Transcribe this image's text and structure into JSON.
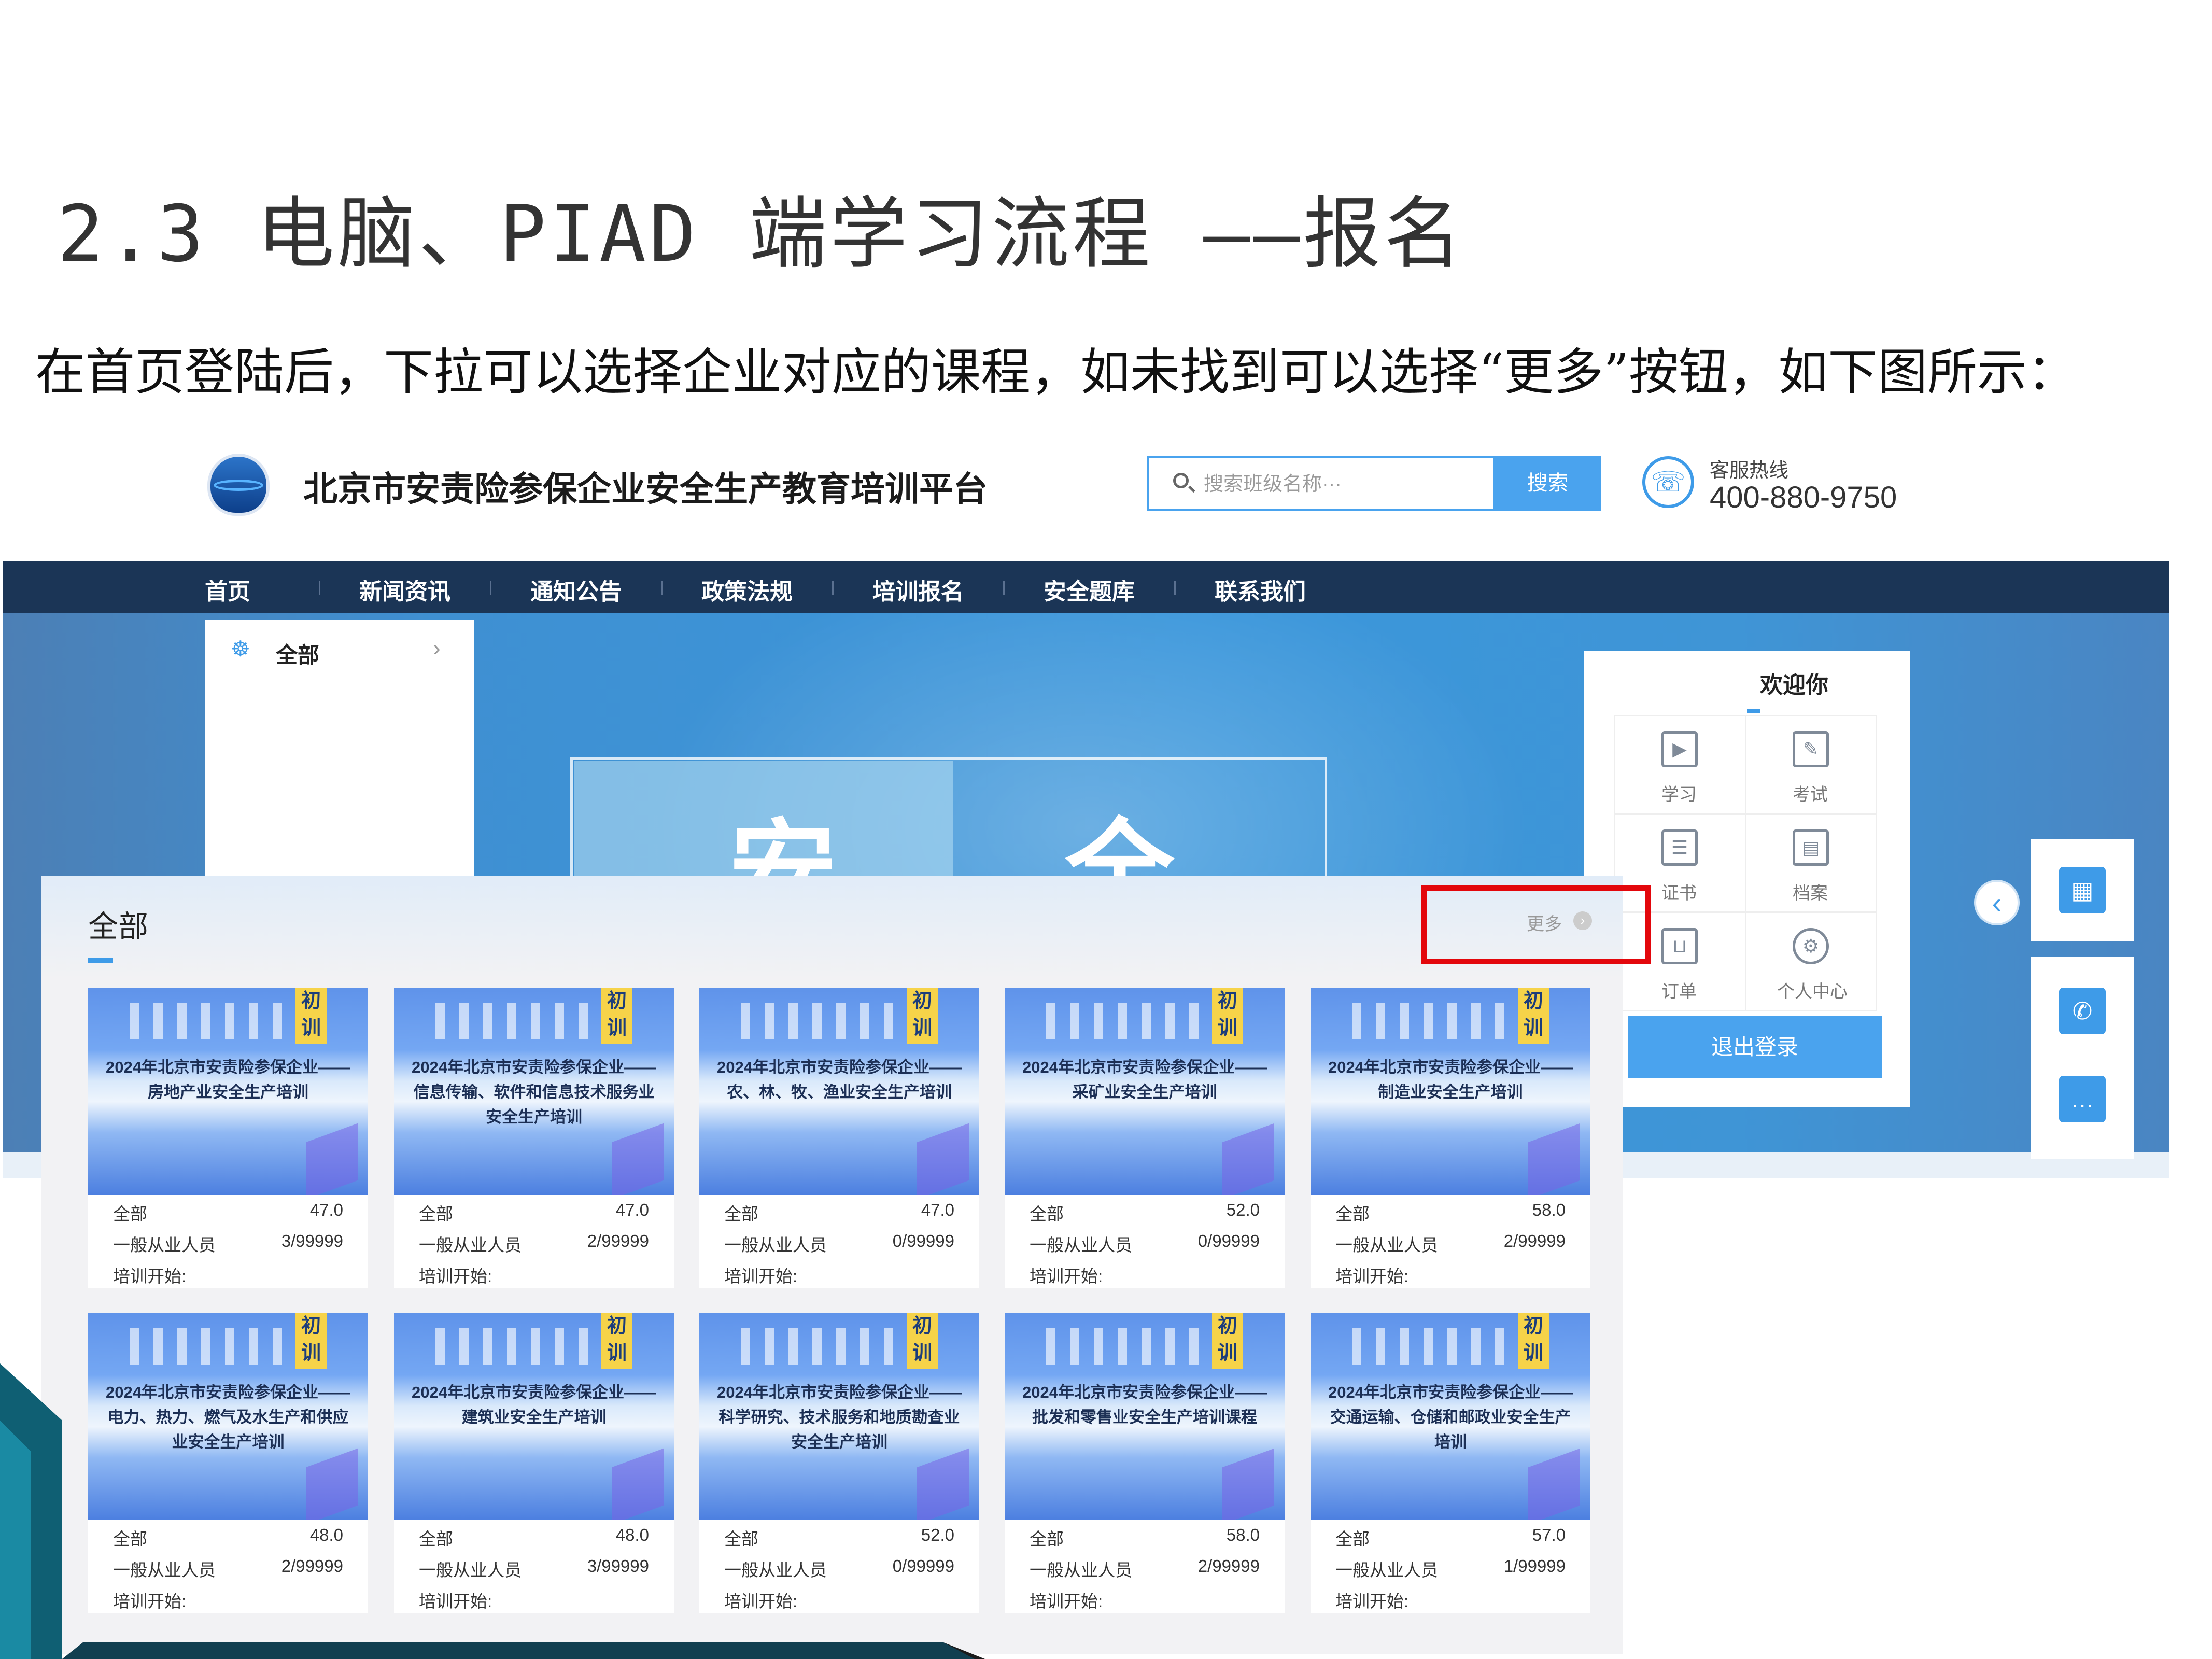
{
  "slide": {
    "title": "2.3 电脑、PIAD 端学习流程 ——报名",
    "description": "在首页登陆后，下拉可以选择企业对应的课程，如未找到可以选择“更多”按钮，如下图所示："
  },
  "site": {
    "name": "北京市安责险参保企业安全生产教育培训平台",
    "search_placeholder": "搜索班级名称···",
    "search_button": "搜索",
    "hotline_label": "客服热线",
    "hotline_number": "400-880-9750"
  },
  "nav": [
    "首页",
    "新闻资讯",
    "通知公告",
    "政策法规",
    "培训报名",
    "安全题库",
    "联系我们"
  ],
  "category": {
    "label": "全部"
  },
  "banner": {
    "chars": [
      "安",
      "全"
    ]
  },
  "welcome": {
    "title": "欢迎你",
    "items": [
      "学习",
      "考试",
      "证书",
      "档案",
      "订单",
      "个人中心"
    ],
    "logout": "退出登录"
  },
  "panel": {
    "title": "全部",
    "more": "更多"
  },
  "course_labels": {
    "category": "全部",
    "role": "一般从业人员",
    "start": "培训开始:"
  },
  "courses": [
    {
      "badge": "初训",
      "title": "2024年北京市安责险参保企业——房地产业安全生产培训",
      "price": "47.0",
      "enrolled": "3/99999"
    },
    {
      "badge": "初训",
      "title": "2024年北京市安责险参保企业——信息传输、软件和信息技术服务业安全生产培训",
      "price": "47.0",
      "enrolled": "2/99999"
    },
    {
      "badge": "初训",
      "title": "2024年北京市安责险参保企业——农、林、牧、渔业安全生产培训",
      "price": "47.0",
      "enrolled": "0/99999"
    },
    {
      "badge": "初训",
      "title": "2024年北京市安责险参保企业——采矿业安全生产培训",
      "price": "52.0",
      "enrolled": "0/99999"
    },
    {
      "badge": "初训",
      "title": "2024年北京市安责险参保企业——制造业安全生产培训",
      "price": "58.0",
      "enrolled": "2/99999"
    },
    {
      "badge": "初训",
      "title": "2024年北京市安责险参保企业——电力、热力、燃气及水生产和供应业安全生产培训",
      "price": "48.0",
      "enrolled": "2/99999"
    },
    {
      "badge": "初训",
      "title": "2024年北京市安责险参保企业——建筑业安全生产培训",
      "price": "48.0",
      "enrolled": "3/99999"
    },
    {
      "badge": "初训",
      "title": "2024年北京市安责险参保企业——科学研究、技术服务和地质勘查业安全生产培训",
      "price": "52.0",
      "enrolled": "0/99999"
    },
    {
      "badge": "初训",
      "title": "2024年北京市安责险参保企业——批发和零售业安全生产培训课程",
      "price": "58.0",
      "enrolled": "2/99999"
    },
    {
      "badge": "初训",
      "title": "2024年北京市安责险参保企业——交通运输、仓储和邮政业安全生产培训",
      "price": "57.0",
      "enrolled": "1/99999"
    }
  ],
  "colors": {
    "accent": "#4aa3ee",
    "nav": "#1b3556",
    "highlight": "#e3070c",
    "badge": "#f6d349"
  }
}
